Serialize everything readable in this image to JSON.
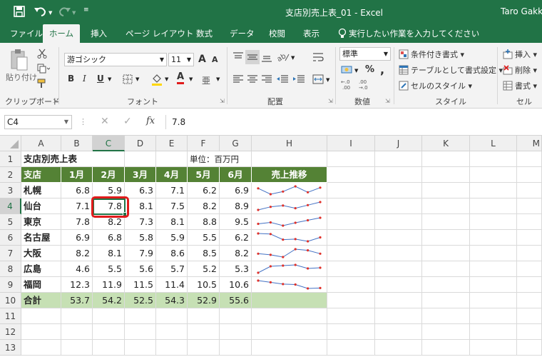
{
  "window": {
    "title": "支店別売上表_01 - Excel",
    "user": "Taro Gakk"
  },
  "tabs": [
    {
      "label": "ファイル"
    },
    {
      "label": "ホーム"
    },
    {
      "label": "挿入"
    },
    {
      "label": "ページ レイアウト"
    },
    {
      "label": "数式"
    },
    {
      "label": "データ"
    },
    {
      "label": "校閲"
    },
    {
      "label": "表示"
    }
  ],
  "tell_me": "実行したい作業を入力してください",
  "ribbon": {
    "clipboard": {
      "label": "クリップボード",
      "paste": "貼り付け"
    },
    "font": {
      "label": "フォント",
      "name": "游ゴシック",
      "size": "11",
      "grow": "A",
      "shrink": "A",
      "bold": "B",
      "italic": "I",
      "underline": "U",
      "font_color": "A"
    },
    "alignment": {
      "label": "配置"
    },
    "number": {
      "label": "数値",
      "format": "標準",
      "percent": "%",
      "comma": ","
    },
    "styles": {
      "label": "スタイル",
      "cond": "条件付き書式",
      "table": "テーブルとして書式設定",
      "cell_style": "セルのスタイル"
    },
    "cells": {
      "label": "セル",
      "insert": "挿入",
      "delete": "削除",
      "format": "書式"
    }
  },
  "formula_bar": {
    "name_box": "C4",
    "fx": "fx",
    "value": "7.8"
  },
  "columns": [
    "A",
    "B",
    "C",
    "D",
    "E",
    "F",
    "G",
    "H",
    "I",
    "J",
    "K",
    "L",
    "M"
  ],
  "rows": [
    "1",
    "2",
    "3",
    "4",
    "5",
    "6",
    "7",
    "8",
    "9",
    "10",
    "11",
    "12",
    "13"
  ],
  "sheet": {
    "title": "支店別売上表",
    "unit": "単位：百万円",
    "headers": [
      "支店",
      "1月",
      "2月",
      "3月",
      "4月",
      "5月",
      "6月",
      "売上推移"
    ],
    "data": [
      {
        "branch": "札幌",
        "values": [
          "6.8",
          "5.9",
          "6.3",
          "7.1",
          "6.2",
          "6.9"
        ]
      },
      {
        "branch": "仙台",
        "values": [
          "7.1",
          "7.8",
          "8.1",
          "7.5",
          "8.2",
          "8.9"
        ]
      },
      {
        "branch": "東京",
        "values": [
          "7.8",
          "8.2",
          "7.3",
          "8.1",
          "8.8",
          "9.5"
        ]
      },
      {
        "branch": "名古屋",
        "values": [
          "6.9",
          "6.8",
          "5.8",
          "5.9",
          "5.5",
          "6.2"
        ]
      },
      {
        "branch": "大阪",
        "values": [
          "8.2",
          "8.1",
          "7.9",
          "8.6",
          "8.5",
          "8.2"
        ]
      },
      {
        "branch": "広島",
        "values": [
          "4.6",
          "5.5",
          "5.6",
          "5.7",
          "5.2",
          "5.3"
        ]
      },
      {
        "branch": "福岡",
        "values": [
          "12.3",
          "11.9",
          "11.5",
          "11.4",
          "10.5",
          "10.6"
        ]
      }
    ],
    "total": {
      "label": "合計",
      "values": [
        "53.7",
        "54.2",
        "52.5",
        "54.3",
        "52.9",
        "55.6"
      ]
    }
  },
  "colors": {
    "excel_green": "#217346",
    "header_fill": "#548235",
    "total_fill": "#c6e0b4",
    "sparkline": "#4472c4",
    "marker": "#e0312a",
    "highlight": "#e01b1b"
  }
}
